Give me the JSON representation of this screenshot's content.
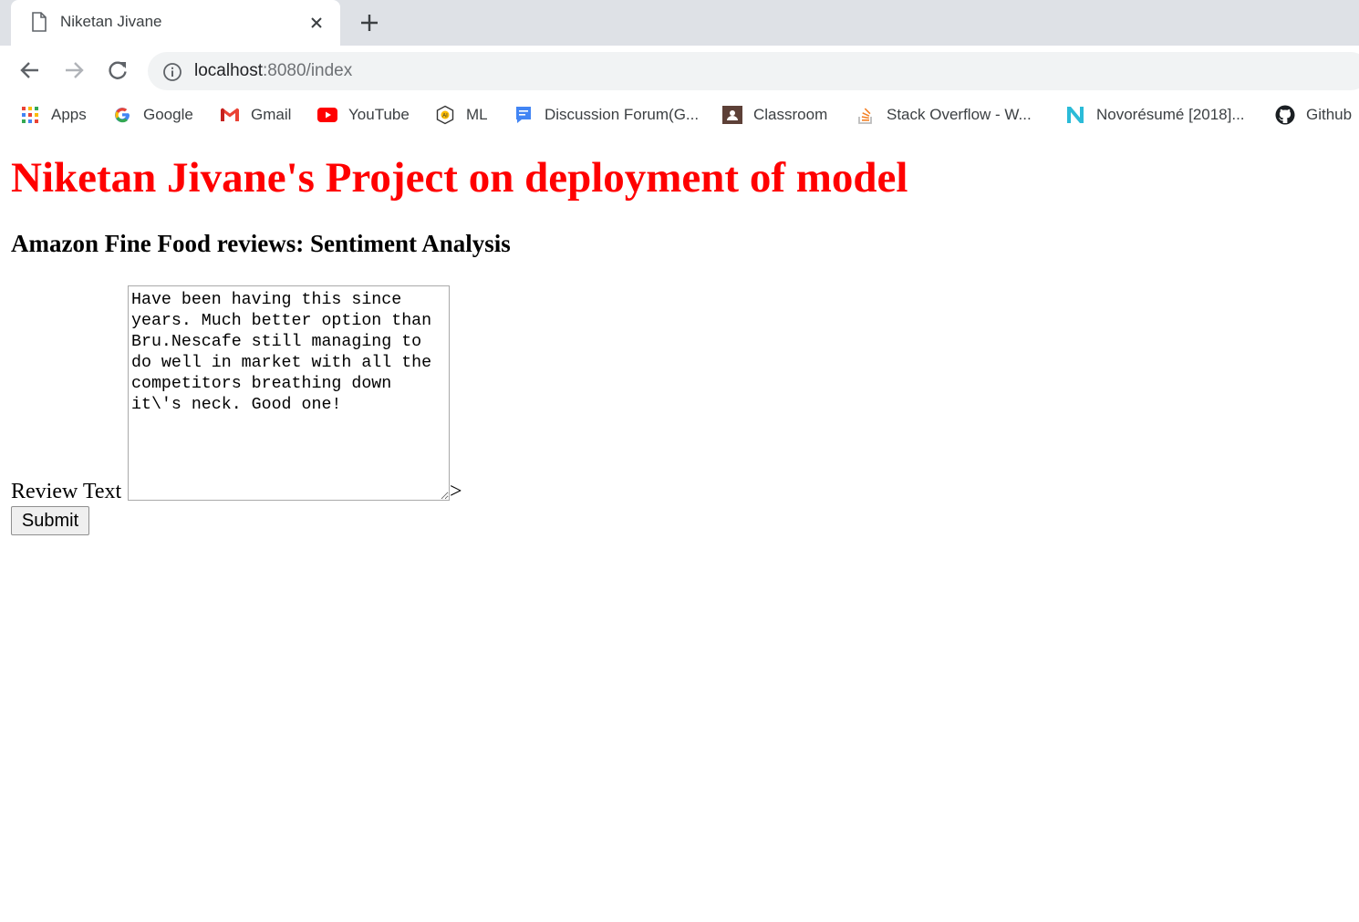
{
  "browser": {
    "tab_title": "Niketan Jivane",
    "url_host": "localhost",
    "url_path": ":8080/index"
  },
  "bookmarks": [
    {
      "label": "Apps",
      "icon": "apps-grid-icon"
    },
    {
      "label": "Google",
      "icon": "google-icon"
    },
    {
      "label": "Gmail",
      "icon": "gmail-icon"
    },
    {
      "label": "YouTube",
      "icon": "youtube-icon"
    },
    {
      "label": "ML",
      "icon": "ml-icon"
    },
    {
      "label": "Discussion Forum(G...",
      "icon": "forum-icon"
    },
    {
      "label": "Classroom",
      "icon": "classroom-icon"
    },
    {
      "label": "Stack Overflow - W...",
      "icon": "stackoverflow-icon"
    },
    {
      "label": "Novorésumé [2018]...",
      "icon": "novoresume-icon"
    },
    {
      "label": "Github",
      "icon": "github-icon"
    }
  ],
  "page": {
    "heading": "Niketan Jivane's Project on deployment of model",
    "subheading": "Amazon Fine Food reviews: Sentiment Analysis",
    "review_label": "Review Text",
    "review_value": "Have been having this since years. Much better option than Bru.Nescafe still managing to do well in market with all the competitors breathing down it\\'s neck. Good one!",
    "stray_text": ">",
    "submit_label": "Submit"
  },
  "colors": {
    "heading": "#ff0000",
    "tabstrip": "#dee1e6",
    "omnibox": "#f1f3f4"
  }
}
